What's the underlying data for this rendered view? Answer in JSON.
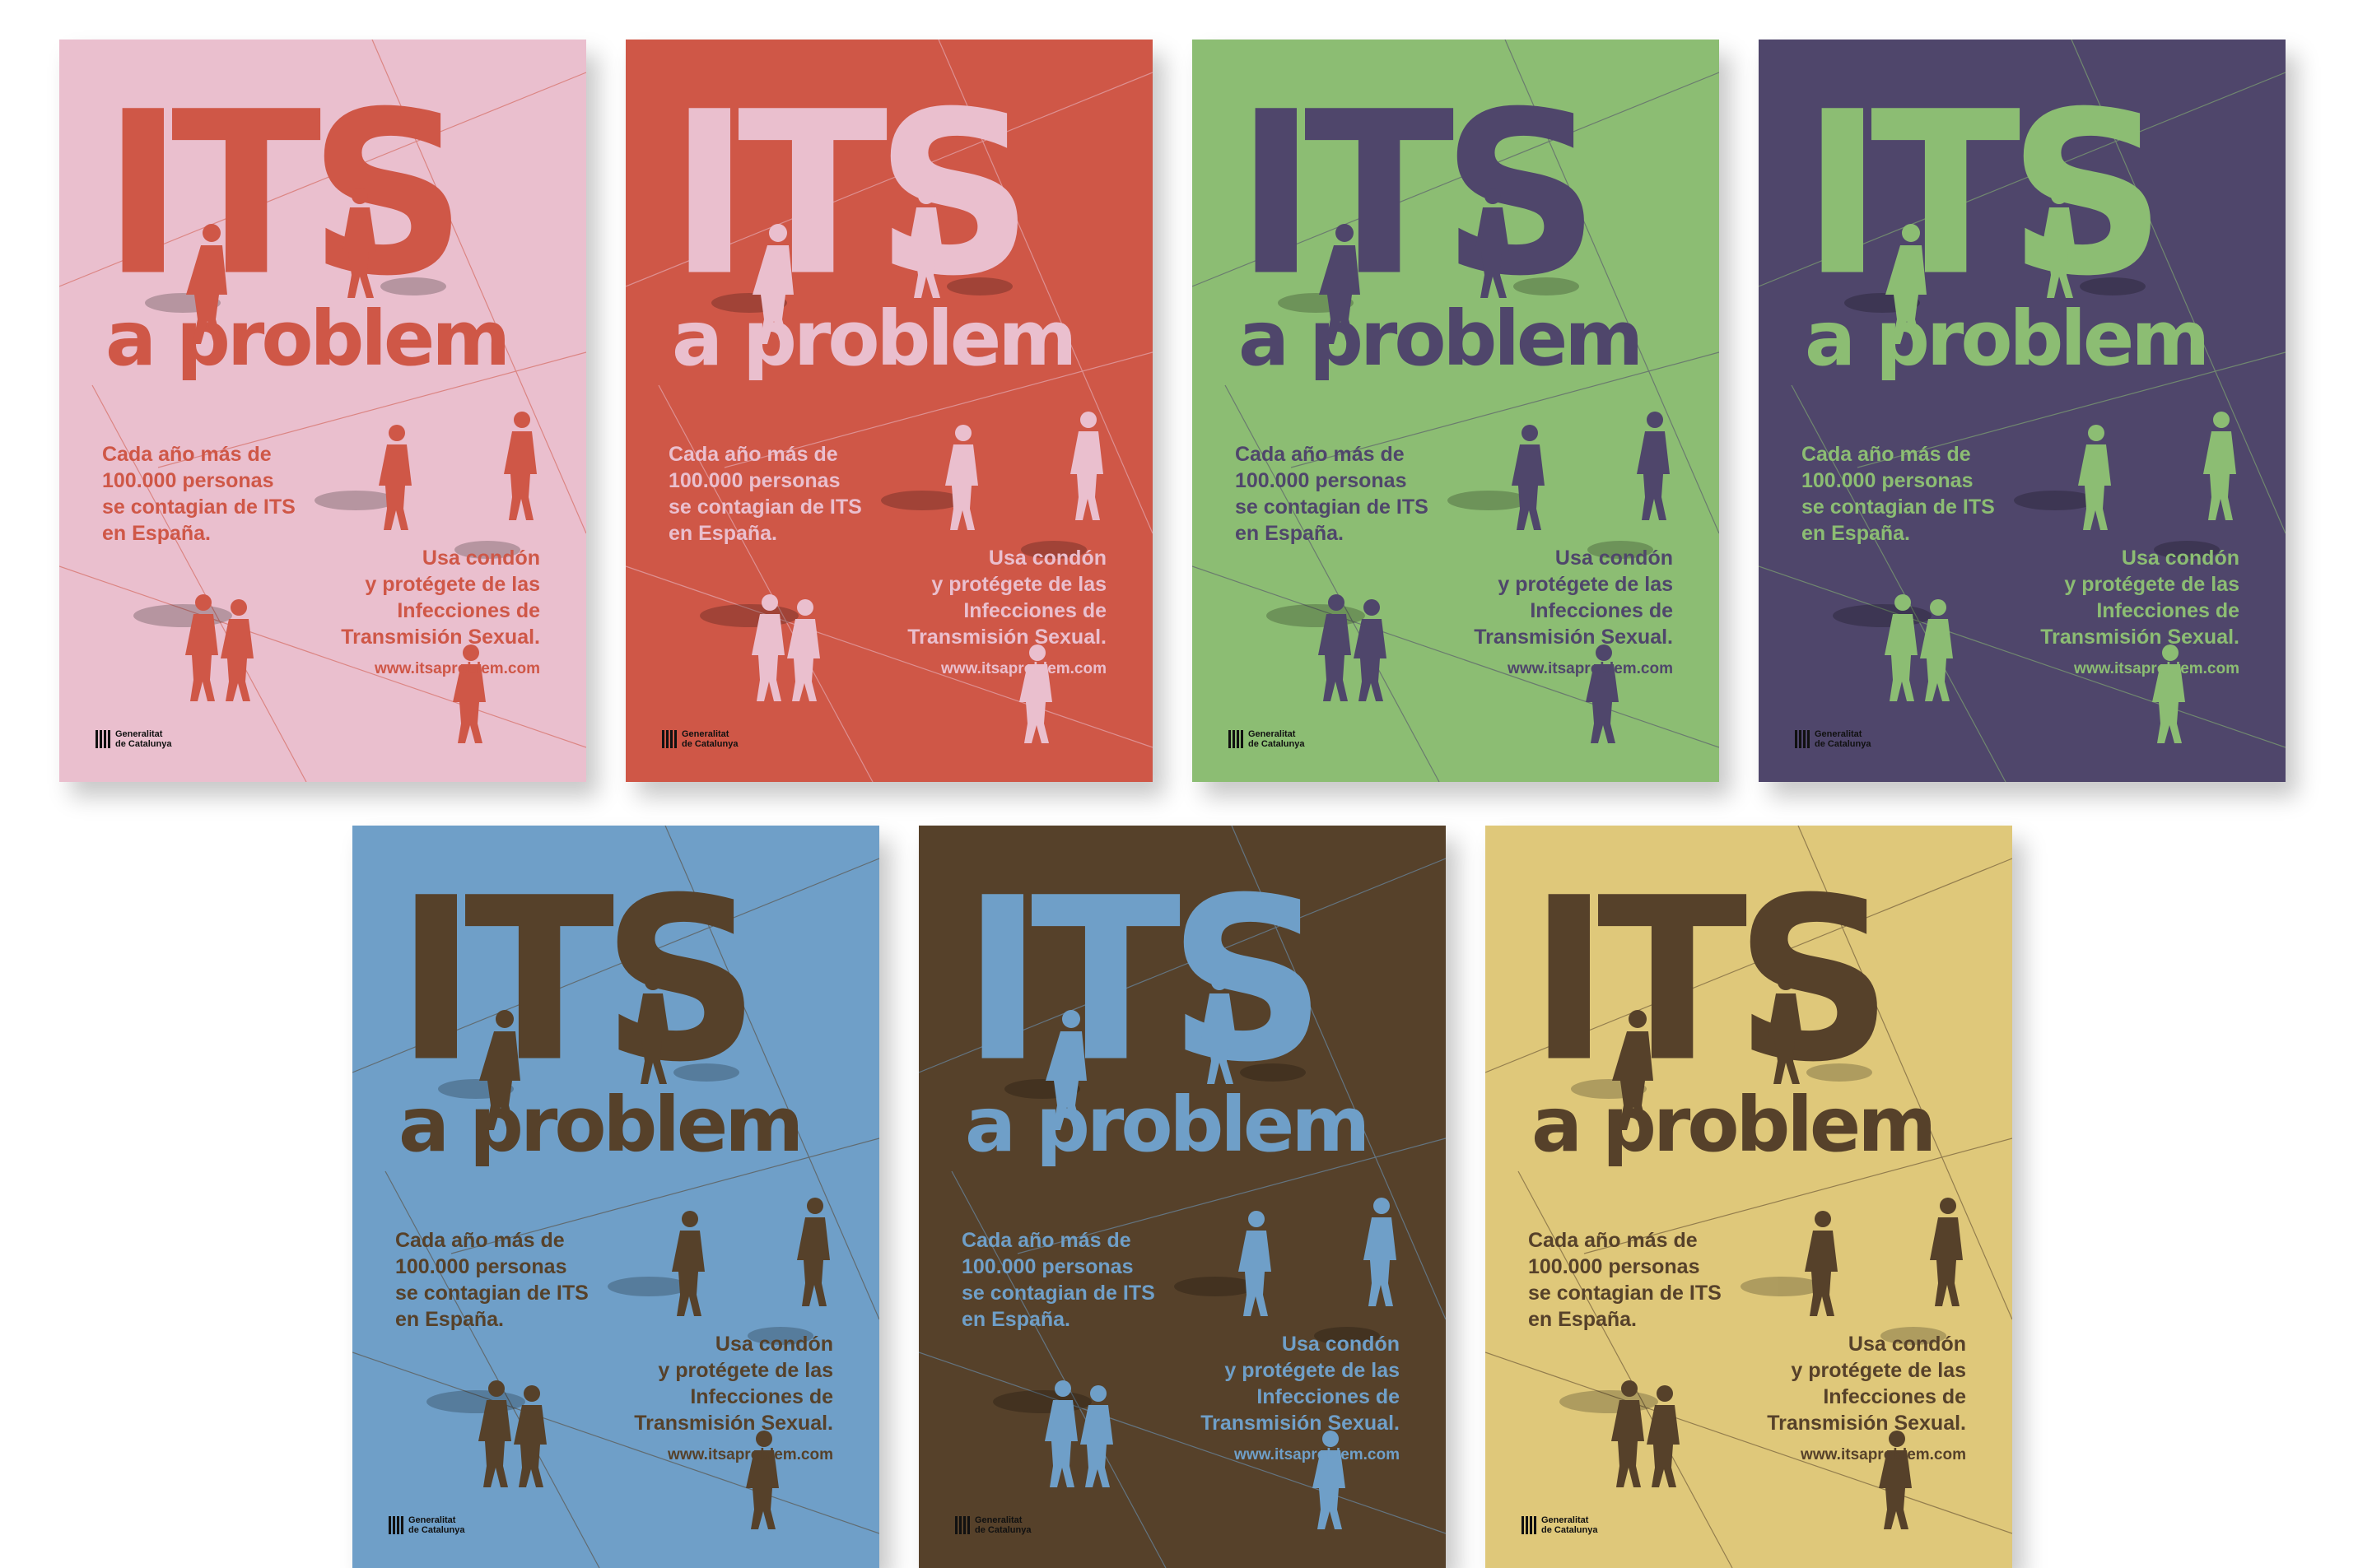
{
  "poster_texts": {
    "title": "ITS",
    "subtitle": "a problem",
    "body1": [
      "Cada año más de",
      "100.000 personas",
      "se contagian de ITS",
      "en España."
    ],
    "body2": [
      "Usa condón",
      "y protégete de las",
      "Infecciones de",
      "Transmisión Sexual."
    ],
    "url": "www.itsaproblem.com",
    "logo": [
      "Generalitat",
      "de Catalunya"
    ]
  },
  "posters": [
    {
      "bg": "#eabfce",
      "fg": "#cf5747"
    },
    {
      "bg": "#cf5747",
      "fg": "#eabfce"
    },
    {
      "bg": "#8cbd73",
      "fg": "#4f466b"
    },
    {
      "bg": "#4f466b",
      "fg": "#8cbd73"
    },
    {
      "bg": "#6f9fc8",
      "fg": "#56412a"
    },
    {
      "bg": "#56412a",
      "fg": "#6f9fc8"
    },
    {
      "bg": "#dfc87a",
      "fg": "#56412a"
    }
  ],
  "icons": {
    "people": "person-silhouette-icon",
    "bike": "bicycle-icon",
    "logo": "generalitat-logo-icon"
  }
}
